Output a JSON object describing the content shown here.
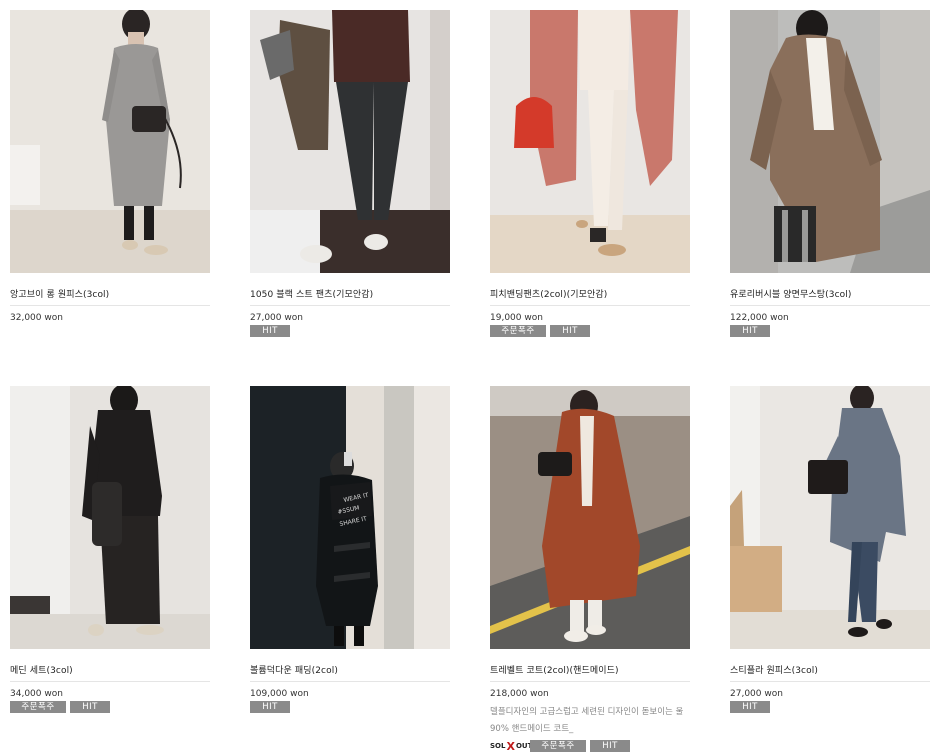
{
  "products": [
    {
      "name": "앙고브이 롱 원피스(3col)",
      "price": "32,000 won",
      "badges": [],
      "description": ""
    },
    {
      "name": "1050 블랙 스트 팬츠(기모안감)",
      "price": "27,000 won",
      "badges": [
        "HIT"
      ],
      "description": ""
    },
    {
      "name": "피치밴딩팬츠(2col)(기모안감)",
      "price": "19,000 won",
      "badges": [
        "주문폭주",
        "HIT"
      ],
      "description": ""
    },
    {
      "name": "유로리버시블 양면무스탕(3col)",
      "price": "122,000 won",
      "badges": [
        "HIT"
      ],
      "description": ""
    },
    {
      "name": "메딘 세트(3col)",
      "price": "34,000 won",
      "badges": [
        "주문폭주",
        "HIT"
      ],
      "description": ""
    },
    {
      "name": "볼륨덕다운 패딩(2col)",
      "price": "109,000 won",
      "badges": [
        "HIT"
      ],
      "description": ""
    },
    {
      "name": "트레벨트 코트(2col)(핸드메이드)",
      "price": "218,000 won",
      "badges": [
        "SOLD OUT",
        "주문폭주",
        "HIT"
      ],
      "description": "델플디자인의 고급스럽고 세련된 디자인이 돋보이는 울90% 핸드메이드 코트_"
    },
    {
      "name": "스티플라 원피스(3col)",
      "price": "27,000 won",
      "badges": [
        "HIT"
      ],
      "description": ""
    }
  ],
  "image_text": {
    "padding_print": "WEAR IT #SSUM SHARE IT"
  },
  "colors": {
    "badge_bg": "#8a8a8a",
    "divider": "#e5e5e5",
    "soldout_x": "#c01c1c"
  }
}
